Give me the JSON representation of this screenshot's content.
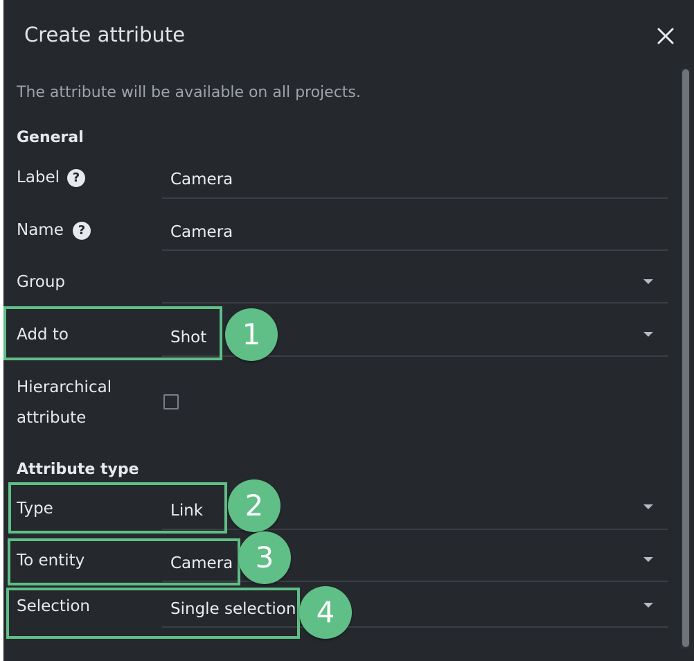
{
  "dialog": {
    "title": "Create attribute",
    "info": "The attribute will be available on all projects."
  },
  "general": {
    "heading": "General",
    "label": {
      "label": "Label",
      "help": "?",
      "value": "Camera"
    },
    "name": {
      "label": "Name",
      "help": "?",
      "value": "Camera"
    },
    "group": {
      "label": "Group",
      "value": ""
    },
    "add_to": {
      "label": "Add to",
      "value": "Shot"
    },
    "hierarchical": {
      "label_line1": "Hierarchical",
      "label_line2": "attribute",
      "checked": false
    }
  },
  "attribute_type": {
    "heading": "Attribute type",
    "type": {
      "label": "Type",
      "value": "Link"
    },
    "to_entity": {
      "label": "To entity",
      "value": "Camera"
    },
    "selection": {
      "label": "Selection",
      "value": "Single selection"
    }
  },
  "callouts": [
    "1",
    "2",
    "3",
    "4"
  ],
  "colors": {
    "dialog_bg": "#25282d",
    "text": "#e7e9ec",
    "muted_text": "#9ea3aa",
    "highlight": "#5fbf86"
  }
}
